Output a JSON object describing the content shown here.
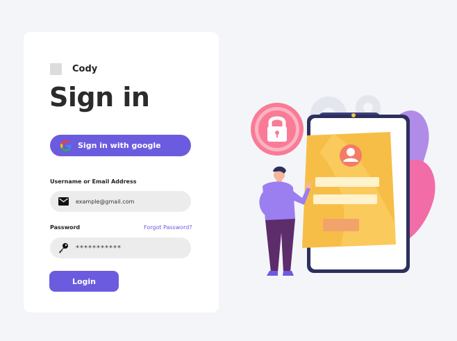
{
  "brand": {
    "name": "Cody"
  },
  "page": {
    "title": "Sign in"
  },
  "google_button": {
    "label": "Sign in with google",
    "icon": "google-icon"
  },
  "username": {
    "label": "Username or Email Address",
    "value": "example@gmail.com",
    "icon": "mail-icon"
  },
  "password": {
    "label": "Password",
    "value": "***********",
    "forgot_link": "Forgot Password?",
    "icon": "key-icon"
  },
  "login_button": {
    "label": "Login"
  },
  "colors": {
    "accent": "#6b5bde",
    "background": "#f4f5f9",
    "card": "#ffffff",
    "field": "#ececec"
  }
}
